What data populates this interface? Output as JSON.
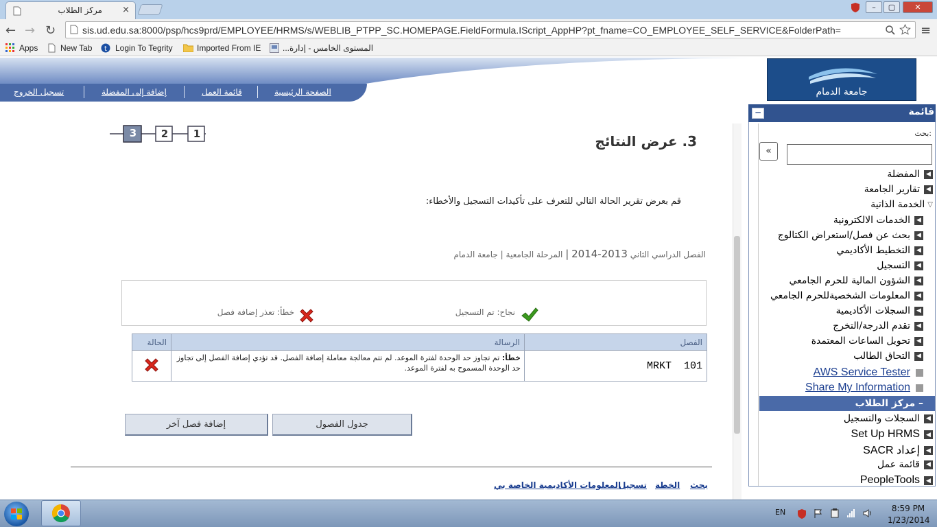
{
  "browser": {
    "tab_title": "مركز الطلاب",
    "tab_close": "×",
    "url": "sis.ud.edu.sa:8000/psp/hcs9prd/EMPLOYEE/HRMS/s/WEBLIB_PTPP_SC.HOMEPAGE.FieldFormula.IScript_AppHP?pt_fname=CO_EMPLOYEE_SELF_SERVICE&FolderPath=",
    "window_buttons": {
      "minimize": "–",
      "maximize": "▢",
      "close": "✕"
    },
    "nav": {
      "back": "←",
      "forward": "→",
      "reload": "↻",
      "menu": "≡"
    },
    "bookmarks": [
      {
        "label": "Apps"
      },
      {
        "label": "New Tab"
      },
      {
        "label": "Login To Tegrity"
      },
      {
        "label": "Imported From IE"
      },
      {
        "label": "المستوى الخامس - إدارة..."
      }
    ]
  },
  "header": {
    "nav_links": [
      "الصفحة الرئيسية",
      "قائمة العمل",
      "إضافة إلى المفضلة",
      "تسجيل الخروج"
    ],
    "logo_text": "جامعة الدمام"
  },
  "steps": [
    "1",
    "2",
    "3"
  ],
  "main": {
    "heading": "3. عرض النتائج",
    "instructions": "قم بعرض تقرير الحالة التالي للتعرف على تأكيدات التسجيل والأخطاء:",
    "term_prefix": "الفصل الدراسي الثاني",
    "term_year": "2013-2014",
    "term_sep": "|",
    "term_level": "المرحلة الجامعية",
    "term_sep2": "|",
    "term_institution": "جامعة الدمام",
    "summary": {
      "success": "نجاح: تم التسجيل",
      "error": "خطأ: تعذر إضافة فصل"
    },
    "table": {
      "headers": {
        "class": "الفصل",
        "message": "الرسالة",
        "status": "الحالة"
      },
      "rows": [
        {
          "class": "MRKT  101",
          "message_label": "خطأ:",
          "message": "تم تجاوز حد الوحدة لفترة الموعد. لم تتم معالجة معاملة إضافة الفصل. قد تؤدي إضافة الفصل إلى تجاوز حد الوحدة المسموح به لفترة الموعد."
        }
      ]
    },
    "buttons": {
      "schedule": "جدول الفصول",
      "add_another": "إضافة فصل آخر"
    },
    "footer_links": [
      "بحث",
      "الخطة",
      "تسجيل",
      "المعلومات الأكاديمية الخاصة بي"
    ]
  },
  "menu": {
    "title": "قائمة",
    "collapse": "−",
    "search_label": "بحث:",
    "search_value": "",
    "search_button": "«",
    "items": [
      {
        "label": "المفضلة",
        "level": 0
      },
      {
        "label": "تقارير الجامعة",
        "level": 0
      },
      {
        "label": "الخدمة الذاتية",
        "level": 0
      },
      {
        "label": "الخدمات الالكترونية",
        "level": 1
      },
      {
        "label": "بحث عن فصل/استعراض الكتالوج",
        "level": 1
      },
      {
        "label": "التخطيط الأكاديمي",
        "level": 1
      },
      {
        "label": "التسجيل",
        "level": 1
      },
      {
        "label": "الشؤون المالية للحرم الجامعي",
        "level": 1
      },
      {
        "label": "المعلومات الشخصيةللحرم الجامعي",
        "level": 1
      },
      {
        "label": "السجلات الأكاديمية",
        "level": 1
      },
      {
        "label": "تقدم الدرجة/التخرج",
        "level": 1
      },
      {
        "label": "تحويل الساعات المعتمدة",
        "level": 1
      },
      {
        "label": "التحاق الطالب",
        "level": 1
      },
      {
        "label": "AWS Service Tester",
        "level": 1
      },
      {
        "label": "Share My Information",
        "level": 1
      },
      {
        "label": "– مركز الطلاب",
        "level": 1
      },
      {
        "label": "السجلات والتسجيل",
        "level": 0
      },
      {
        "label": "Set Up HRMS",
        "level": 0
      },
      {
        "label": "إعداد SACR",
        "level": 0
      },
      {
        "label": "قائمة عمل",
        "level": 0
      },
      {
        "label": "PeopleTools",
        "level": 0
      }
    ]
  },
  "taskbar": {
    "language": "EN",
    "time": "8:59 PM",
    "date": "1/23/2014"
  },
  "colors": {
    "header_blue": "#4a6aa8",
    "menu_head": "#31538f",
    "success_green": "#3b9a1e",
    "error_red": "#d9261c"
  }
}
